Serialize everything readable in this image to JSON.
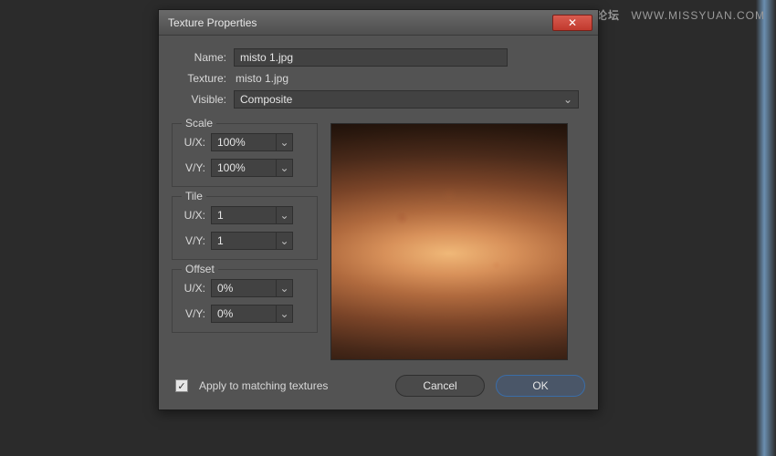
{
  "watermark": {
    "cn": "思缘设计论坛",
    "url": "WWW.MISSYUAN.COM"
  },
  "dialog": {
    "title": "Texture Properties",
    "close_symbol": "✕",
    "fields": {
      "name_label": "Name:",
      "name_value": "misto 1.jpg",
      "texture_label": "Texture:",
      "texture_value": "misto 1.jpg",
      "visible_label": "Visible:",
      "visible_value": "Composite"
    },
    "groups": {
      "scale": {
        "legend": "Scale",
        "ux_label": "U/X:",
        "ux": "100%",
        "vy_label": "V/Y:",
        "vy": "100%"
      },
      "tile": {
        "legend": "Tile",
        "ux_label": "U/X:",
        "ux": "1",
        "vy_label": "V/Y:",
        "vy": "1"
      },
      "offset": {
        "legend": "Offset",
        "ux_label": "U/X:",
        "ux": "0%",
        "vy_label": "V/Y:",
        "vy": "0%"
      }
    },
    "footer": {
      "apply_label": "Apply to matching textures",
      "apply_checked": true,
      "cancel": "Cancel",
      "ok": "OK"
    }
  }
}
